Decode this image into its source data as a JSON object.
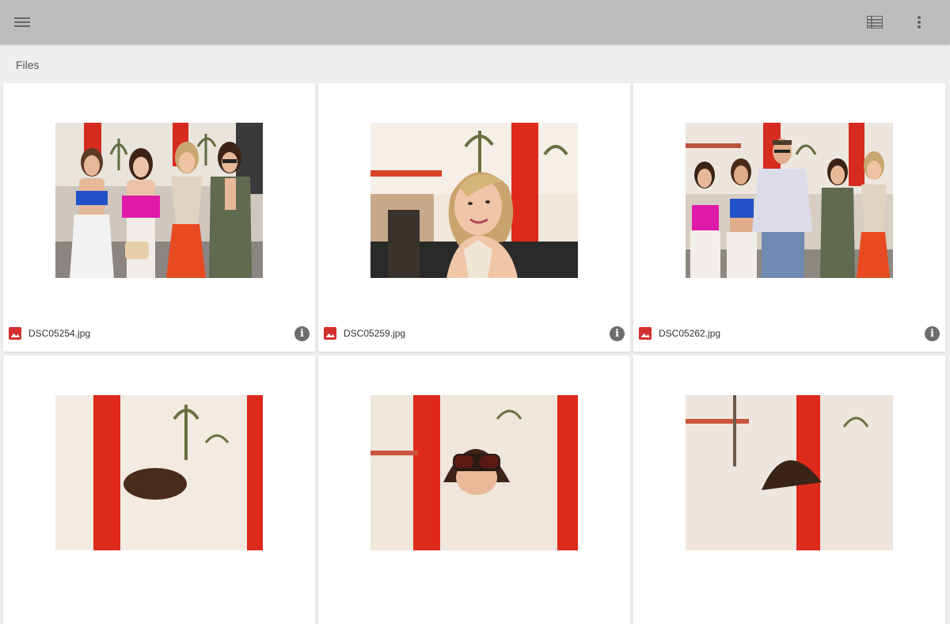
{
  "header": {
    "menu_icon": "menu-icon",
    "list_view_icon": "list-view-icon",
    "more_icon": "more-vert-icon"
  },
  "breadcrumb": {
    "label": "Files"
  },
  "files": [
    {
      "name": "DSC05254.jpg",
      "type_icon": "image-icon",
      "info_icon": "info-icon"
    },
    {
      "name": "DSC05259.jpg",
      "type_icon": "image-icon",
      "info_icon": "info-icon"
    },
    {
      "name": "DSC05262.jpg",
      "type_icon": "image-icon",
      "info_icon": "info-icon"
    },
    {
      "name": "",
      "type_icon": "image-icon"
    },
    {
      "name": "",
      "type_icon": "image-icon"
    },
    {
      "name": "",
      "type_icon": "image-icon"
    }
  ],
  "colors": {
    "toolbar": "#bdbdbd",
    "background": "#eeeeee",
    "image_icon": "#d32f2f",
    "info_icon": "#6d6d6d"
  }
}
